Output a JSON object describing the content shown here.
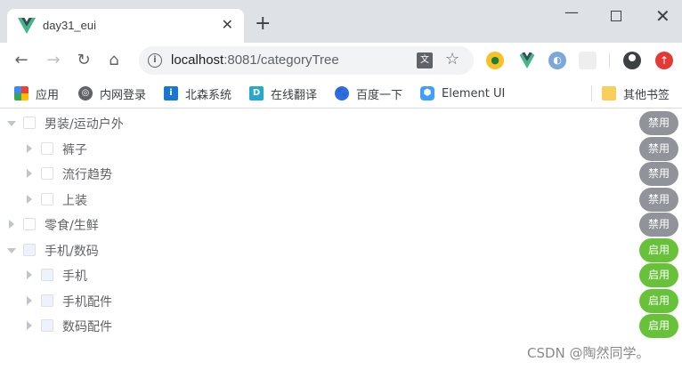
{
  "browser": {
    "tab_title": "day31_eui",
    "url_host": "localhost",
    "url_rest": ":8081/categoryTree",
    "bookmarks": [
      {
        "label": "应用",
        "icon": "apps-grid-icon"
      },
      {
        "label": "内网登录",
        "icon": "globe-icon"
      },
      {
        "label": "北森系统",
        "icon": "beisen-icon"
      },
      {
        "label": "在线翻译",
        "icon": "translate-d-icon"
      },
      {
        "label": "百度一下",
        "icon": "baidu-paw-icon"
      },
      {
        "label": "Element UI",
        "icon": "element-ui-icon"
      }
    ],
    "other_bookmarks": "其他书签"
  },
  "tree": {
    "nodes": [
      {
        "label": "男装/运动户外",
        "level": 0,
        "expand": "expanded",
        "status": "禁用",
        "state": "disabled"
      },
      {
        "label": "裤子",
        "level": 1,
        "expand": "collapsed",
        "status": "禁用",
        "state": "disabled"
      },
      {
        "label": "流行趋势",
        "level": 1,
        "expand": "collapsed",
        "status": "禁用",
        "state": "disabled"
      },
      {
        "label": "上装",
        "level": 1,
        "expand": "collapsed",
        "status": "禁用",
        "state": "disabled"
      },
      {
        "label": "零食/生鲜",
        "level": 0,
        "expand": "collapsed",
        "status": "禁用",
        "state": "disabled"
      },
      {
        "label": "手机/数码",
        "level": 0,
        "expand": "expanded",
        "status": "启用",
        "state": "enabled"
      },
      {
        "label": "手机",
        "level": 1,
        "expand": "collapsed",
        "status": "启用",
        "state": "enabled"
      },
      {
        "label": "手机配件",
        "level": 1,
        "expand": "collapsed",
        "status": "启用",
        "state": "enabled"
      },
      {
        "label": "数码配件",
        "level": 1,
        "expand": "collapsed",
        "status": "启用",
        "state": "enabled"
      }
    ]
  },
  "watermark": "CSDN @陶然同学。",
  "colors": {
    "disabled": "#909399",
    "enabled": "#67c23a",
    "vue_green": "#41b883"
  }
}
